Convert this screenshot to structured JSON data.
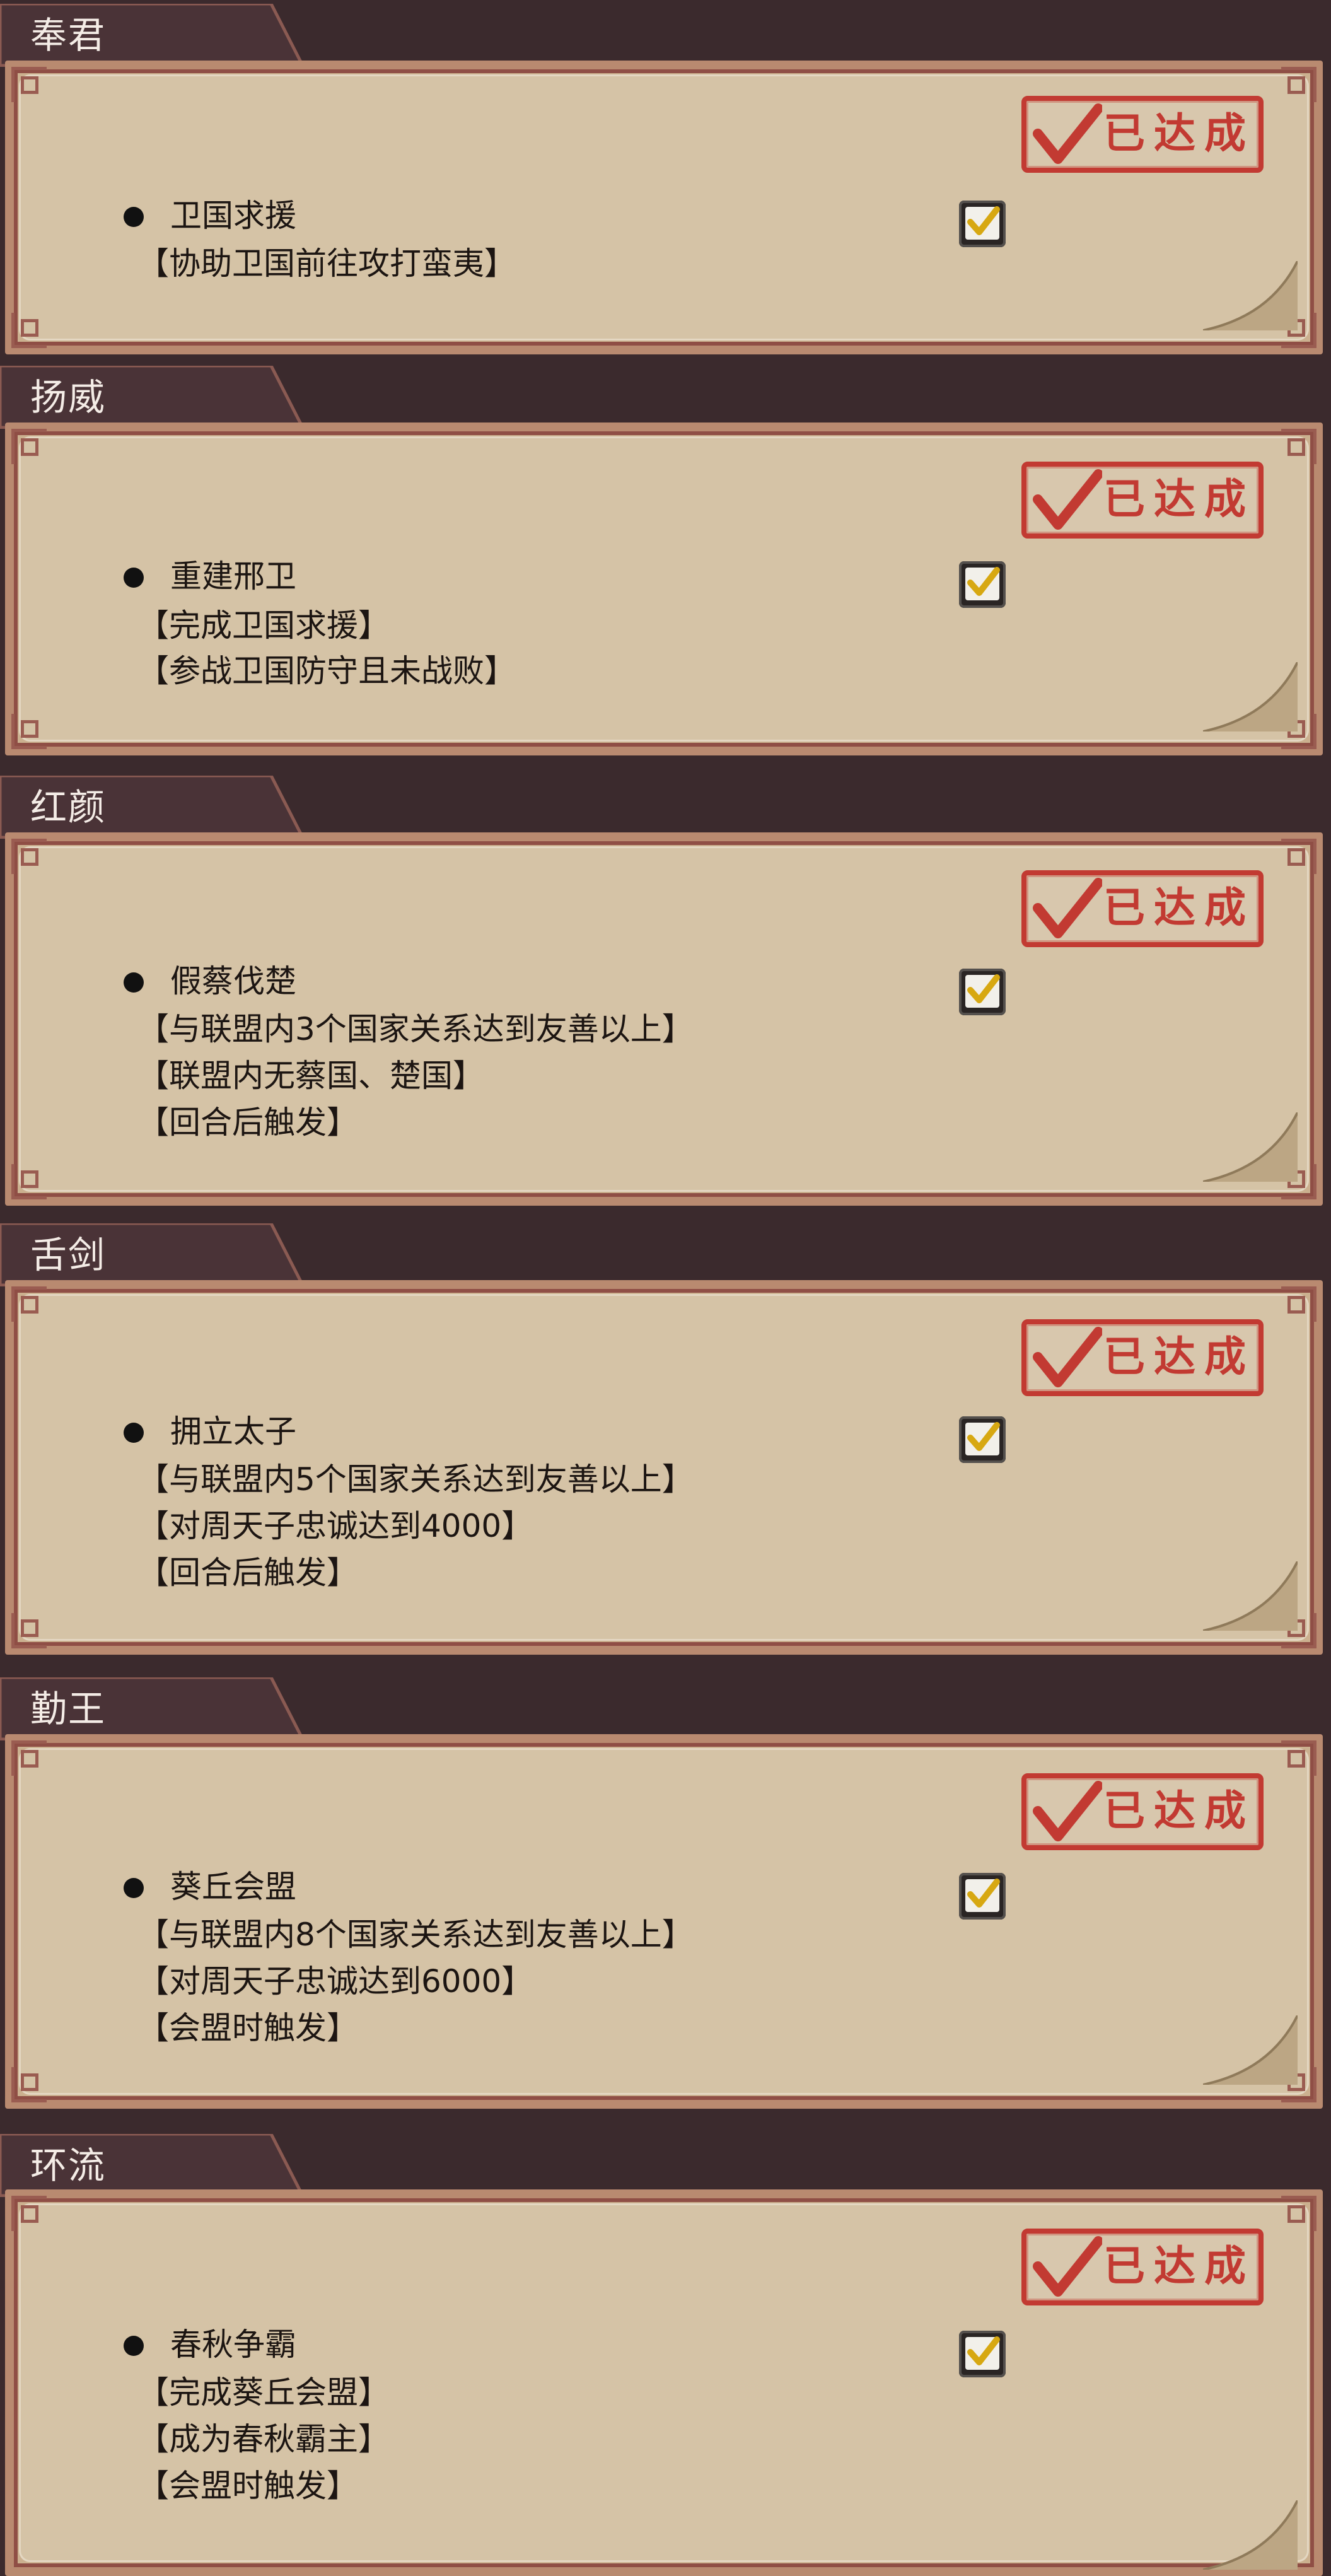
{
  "colors": {
    "background": "#3b2a2d",
    "tab": "#4a3337",
    "frame": "#8f4e45",
    "paper": "#d5c3a6",
    "stamp": "#c23a32",
    "text": "#1c1512"
  },
  "icons": {
    "stamp_check": "red-check-icon",
    "checkbox": "checkbox-checked-icon"
  },
  "sections": [
    {
      "title": "奉君",
      "stamp_label": "已达成",
      "quest_name": "卫国求援",
      "checked": true,
      "conditions": [
        "【协助卫国前往攻打蛮夷】"
      ]
    },
    {
      "title": "扬威",
      "stamp_label": "已达成",
      "quest_name": "重建邢卫",
      "checked": true,
      "conditions": [
        "【完成卫国求援】",
        "【参战卫国防守且未战败】"
      ]
    },
    {
      "title": "红颜",
      "stamp_label": "已达成",
      "quest_name": "假蔡伐楚",
      "checked": true,
      "conditions": [
        "【与联盟内3个国家关系达到友善以上】",
        "【联盟内无蔡国、楚国】",
        "【回合后触发】"
      ]
    },
    {
      "title": "舌剑",
      "stamp_label": "已达成",
      "quest_name": "拥立太子",
      "checked": true,
      "conditions": [
        "【与联盟内5个国家关系达到友善以上】",
        "【对周天子忠诚达到4000】",
        "【回合后触发】"
      ]
    },
    {
      "title": "勤王",
      "stamp_label": "已达成",
      "quest_name": "葵丘会盟",
      "checked": true,
      "conditions": [
        "【与联盟内8个国家关系达到友善以上】",
        "【对周天子忠诚达到6000】",
        "【会盟时触发】"
      ]
    },
    {
      "title": "环流",
      "stamp_label": "已达成",
      "quest_name": "春秋争霸",
      "checked": true,
      "conditions": [
        "【完成葵丘会盟】",
        "【成为春秋霸主】",
        "【会盟时触发】"
      ]
    }
  ]
}
